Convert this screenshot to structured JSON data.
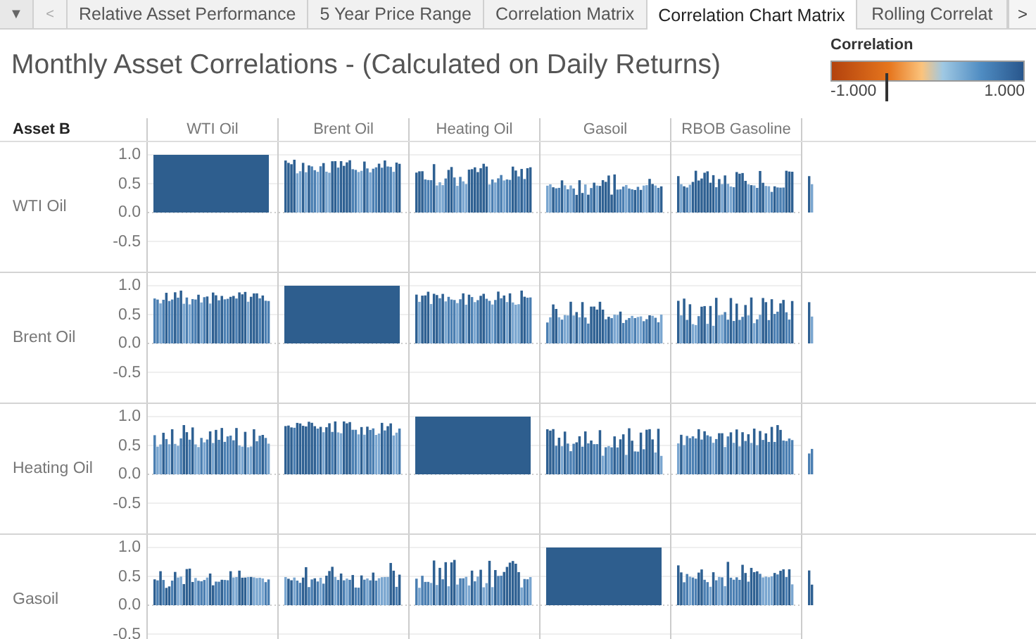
{
  "tab_bar": {
    "menu_glyph": "▼",
    "prev_glyph": "<",
    "next_glyph": ">",
    "tabs": [
      {
        "label": "Relative Asset Performance",
        "selected": false
      },
      {
        "label": "5 Year Price Range",
        "selected": false
      },
      {
        "label": "Correlation Matrix",
        "selected": false
      },
      {
        "label": "Correlation Chart Matrix",
        "selected": true
      },
      {
        "label": "Rolling Correlat",
        "selected": false
      }
    ]
  },
  "title": "Monthly Asset Correlations - (Calculated on Daily Returns)",
  "legend": {
    "title": "Correlation",
    "min_label": "-1.000",
    "max_label": "1.000",
    "level": 0.28
  },
  "matrix": {
    "row_header": "Asset B",
    "columns": [
      "WTI Oil",
      "Brent Oil",
      "Heating Oil",
      "Gasoil",
      "RBOB Gasoline"
    ],
    "rows": [
      {
        "label": "WTI Oil",
        "ticks": [
          "1.0",
          "0.5",
          "0.0",
          "-0.5"
        ],
        "cells": [
          {
            "kind": "diagonal"
          },
          {
            "kind": "bars"
          },
          {
            "kind": "bars"
          },
          {
            "kind": "bars"
          },
          {
            "kind": "bars"
          },
          {
            "kind": "partial"
          }
        ]
      },
      {
        "label": "Brent Oil",
        "ticks": [
          "1.0",
          "0.5",
          "0.0",
          "-0.5"
        ],
        "cells": [
          {
            "kind": "bars"
          },
          {
            "kind": "diagonal"
          },
          {
            "kind": "bars"
          },
          {
            "kind": "bars"
          },
          {
            "kind": "bars"
          },
          {
            "kind": "partial"
          }
        ]
      },
      {
        "label": "Heating Oil",
        "ticks": [
          "1.0",
          "0.5",
          "0.0",
          "-0.5"
        ],
        "cells": [
          {
            "kind": "bars"
          },
          {
            "kind": "bars"
          },
          {
            "kind": "diagonal"
          },
          {
            "kind": "bars"
          },
          {
            "kind": "bars"
          },
          {
            "kind": "partial"
          }
        ]
      },
      {
        "label": "Gasoil",
        "ticks": [
          "1.0",
          "0.5",
          "0.0",
          "-0.5"
        ],
        "cells": [
          {
            "kind": "bars"
          },
          {
            "kind": "bars"
          },
          {
            "kind": "bars"
          },
          {
            "kind": "diagonal"
          },
          {
            "kind": "bars"
          },
          {
            "kind": "partial"
          }
        ]
      }
    ]
  }
}
